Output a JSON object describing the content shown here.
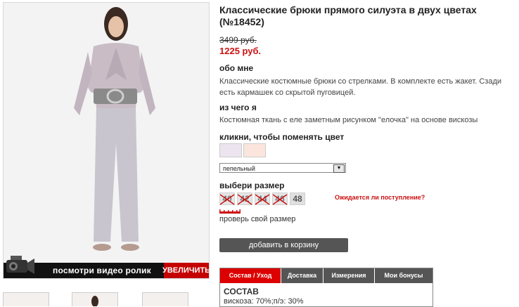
{
  "product": {
    "title": "Классические брюки прямого силуэта в двух цветах (№18452)",
    "old_price": "3499 руб.",
    "new_price": "1225 руб."
  },
  "photo": {
    "video_label": "посмотри видео ролик",
    "zoom_label": "УВЕЛИЧИТЬ"
  },
  "about": {
    "heading": "обо мне",
    "text": "Классические костюмные брюки со стрелками. В комплекте есть жакет. Сзади есть кармашек со скрытой пуговицей."
  },
  "material": {
    "heading": "из чего я",
    "text": "Костюмная ткань с еле заметным рисунком \"елочка\" на основе вискозы"
  },
  "color": {
    "heading": "кликни, чтобы поменять цвет",
    "swatches": [
      "#ece4ee",
      "#fbe5dc"
    ],
    "selected": "пепельный"
  },
  "size": {
    "heading": "выбери размер",
    "options": [
      {
        "label": "40",
        "available": false
      },
      {
        "label": "42",
        "available": false
      },
      {
        "label": "44",
        "available": false
      },
      {
        "label": "46",
        "available": false
      },
      {
        "label": "48",
        "available": true
      }
    ],
    "arrival_link": "Ожидается ли поступление?",
    "check_size": "проверь свой размер"
  },
  "cart": {
    "add_label": "добавить в корзину"
  },
  "tabs": {
    "items": [
      "Состав / Уход",
      "Доставка",
      "Измерения",
      "Мои бонусы"
    ],
    "active_index": 0,
    "content_title": "СОСТАВ",
    "content_text": "вискоза: 70%;п/э: 30%"
  },
  "colors": {
    "accent_red": "#dd0000",
    "price_red": "#cc1111",
    "dark_button": "#555555"
  }
}
